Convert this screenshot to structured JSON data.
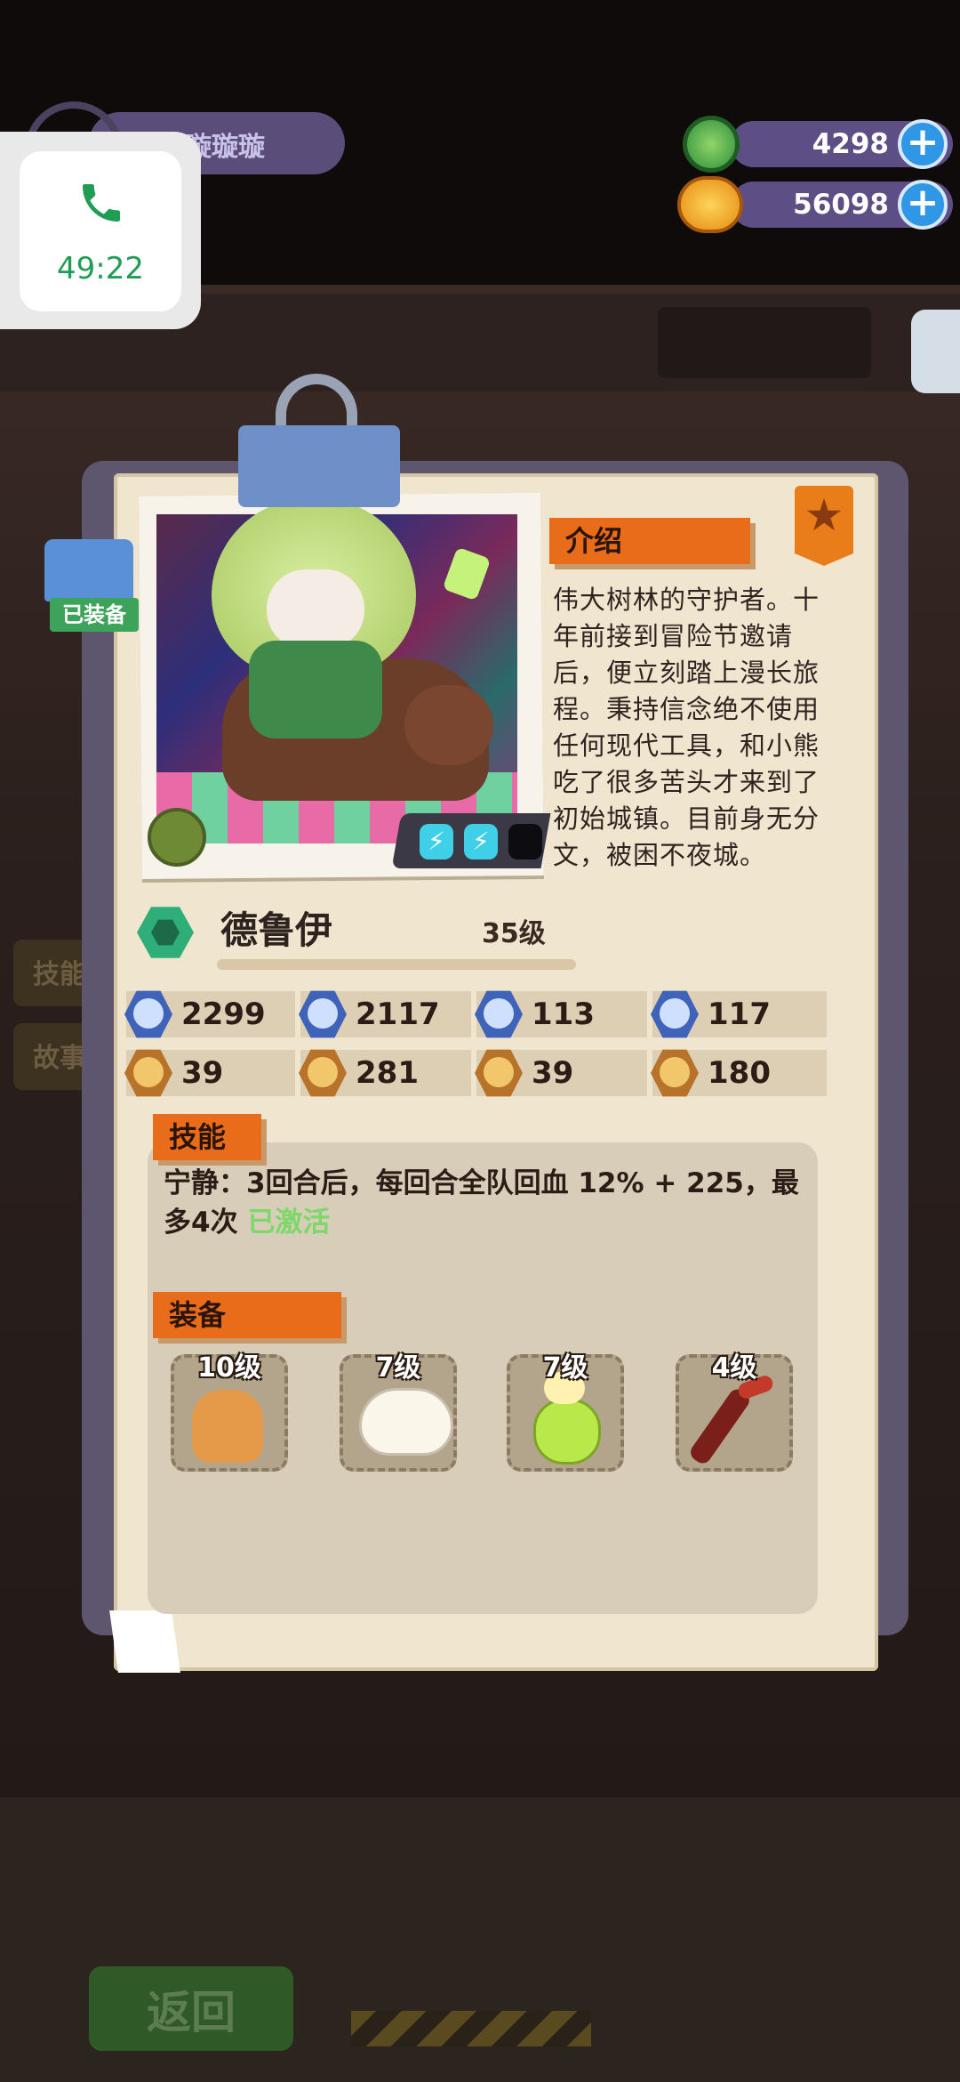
{
  "player": {
    "name": "璇璇璇璇璇"
  },
  "call": {
    "time": "49:22"
  },
  "currency": [
    {
      "icon": "green-gem-coin-icon",
      "value": "4298"
    },
    {
      "icon": "orange-planet-coin-icon",
      "value": "56098"
    }
  ],
  "hero": {
    "equipped_label": "已装备",
    "name": "德鲁伊",
    "level": "35级",
    "energy": [
      "⚡",
      "⚡",
      ""
    ],
    "intro_title": "介绍",
    "intro": "伟大树林的守护者。十年前接到冒险节邀请后，便立刻踏上漫长旅程。秉持信念绝不使用任何现代工具，和小熊吃了很多苦头才来到了初始城镇。目前身无分文，被困不夜城。"
  },
  "stats": [
    {
      "icon": "heart-icon",
      "value": "2299"
    },
    {
      "icon": "sword-icon",
      "value": "2117"
    },
    {
      "icon": "shield-icon",
      "value": "113"
    },
    {
      "icon": "magic-shield-icon",
      "value": "117"
    },
    {
      "icon": "speed-icon",
      "value": "39"
    },
    {
      "icon": "smile-icon",
      "value": "281"
    },
    {
      "icon": "muscle-icon",
      "value": "39"
    },
    {
      "icon": "swirl-icon",
      "value": "180"
    }
  ],
  "skill": {
    "title": "技能",
    "text": "宁静：3回合后，每回合全队回血 12% + 225，最多4次",
    "status": "已激活"
  },
  "equipment": {
    "title": "装备",
    "items": [
      {
        "name": "gingerbread-bear",
        "level": "10级"
      },
      {
        "name": "white-bird",
        "level": "7级"
      },
      {
        "name": "potion-bottle",
        "level": "7级"
      },
      {
        "name": "red-branch",
        "level": "4级"
      }
    ]
  },
  "background": {
    "tabs": [
      "技能",
      "故事"
    ],
    "back_label": "返回"
  },
  "colors": {
    "accent": "#e86c1a",
    "card": "#f0e6cf",
    "active": "#7dd86a"
  }
}
